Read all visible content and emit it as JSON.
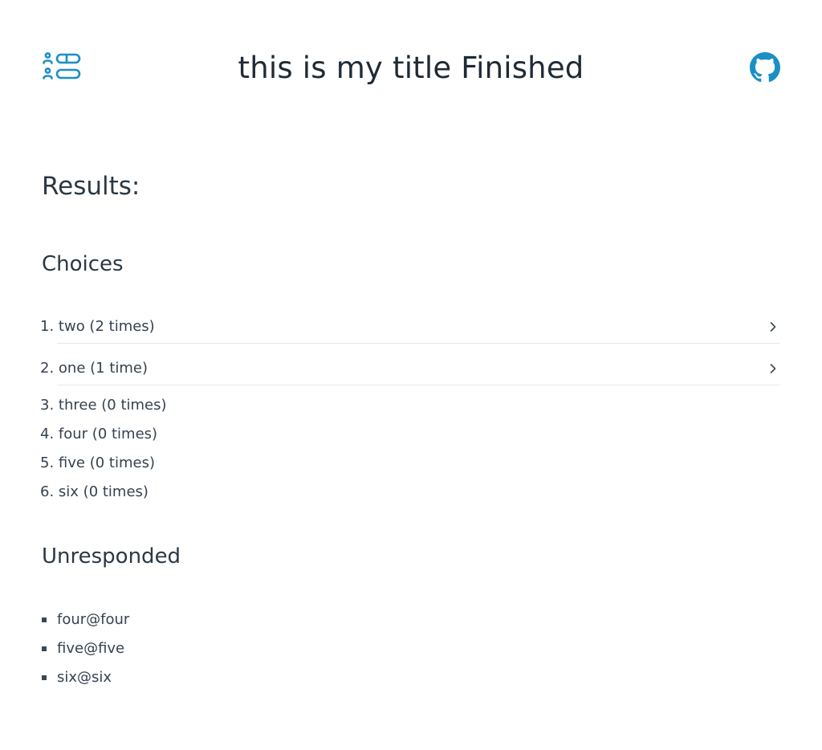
{
  "header": {
    "title": "this is my title Finished",
    "logo_icon": "poll-list-icon",
    "github_icon": "github-icon",
    "accent_color": "#1a8fc7"
  },
  "results": {
    "heading": "Results:"
  },
  "choices": {
    "heading": "Choices",
    "items": [
      {
        "number": "1.",
        "label": "two (2 times)",
        "expandable": true
      },
      {
        "number": "2.",
        "label": "one (1 time)",
        "expandable": true
      },
      {
        "number": "3.",
        "label": "three (0 times)",
        "expandable": false
      },
      {
        "number": "4.",
        "label": "four (0 times)",
        "expandable": false
      },
      {
        "number": "5.",
        "label": "five (0 times)",
        "expandable": false
      },
      {
        "number": "6.",
        "label": "six (0 times)",
        "expandable": false
      }
    ]
  },
  "unresponded": {
    "heading": "Unresponded",
    "items": [
      "four@four",
      "five@five",
      "six@six"
    ]
  }
}
